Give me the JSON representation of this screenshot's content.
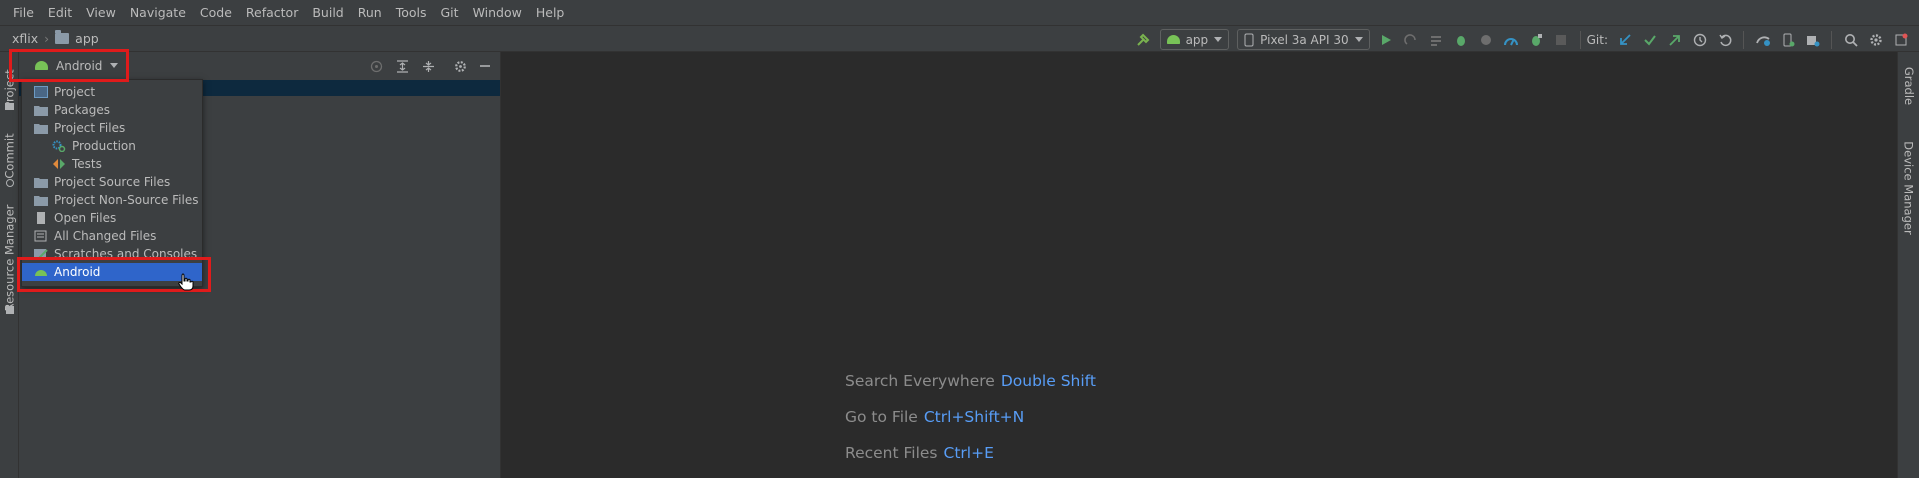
{
  "menu": [
    "File",
    "Edit",
    "View",
    "Navigate",
    "Code",
    "Refactor",
    "Build",
    "Run",
    "Tools",
    "Git",
    "Window",
    "Help"
  ],
  "breadcrumb": {
    "project": "xflix",
    "module": "app"
  },
  "toolbar": {
    "run_config": "app",
    "device": "Pixel 3a API 30",
    "git_label": "Git:"
  },
  "left_strip": {
    "project_tab": "Project",
    "commit_tab": "Commit",
    "resource_tab": "Resource Manager"
  },
  "right_strip": {
    "gradle_tab": "Gradle",
    "device_manager_tab": "Device Manager"
  },
  "project_panel": {
    "view_selector": "Android"
  },
  "view_popup": {
    "items": [
      {
        "label": "Project",
        "icon": "project-view-icon",
        "indent": false
      },
      {
        "label": "Packages",
        "icon": "packages-icon",
        "indent": false
      },
      {
        "label": "Project Files",
        "icon": "folder-icon",
        "indent": false
      },
      {
        "label": "Production",
        "icon": "production-scope-icon",
        "indent": true
      },
      {
        "label": "Tests",
        "icon": "tests-scope-icon",
        "indent": true
      },
      {
        "label": "Project Source Files",
        "icon": "folder-icon",
        "indent": false
      },
      {
        "label": "Project Non-Source Files",
        "icon": "folder-icon",
        "indent": false
      },
      {
        "label": "Open Files",
        "icon": "open-files-icon",
        "indent": false
      },
      {
        "label": "All Changed Files",
        "icon": "changed-files-icon",
        "indent": false
      },
      {
        "label": "Scratches and Consoles",
        "icon": "scratches-icon",
        "indent": false
      },
      {
        "label": "Android",
        "icon": "android-icon",
        "indent": false,
        "selected": true
      }
    ]
  },
  "editor_hints": [
    {
      "action": "Search Everywhere",
      "shortcut": "Double Shift"
    },
    {
      "action": "Go to File",
      "shortcut": "Ctrl+Shift+N"
    },
    {
      "action": "Recent Files",
      "shortcut": "Ctrl+E"
    }
  ],
  "colors": {
    "highlight_box": "#e01b1b",
    "selection": "#2f65ca",
    "shortcut": "#589df6",
    "android": "#78c257"
  }
}
